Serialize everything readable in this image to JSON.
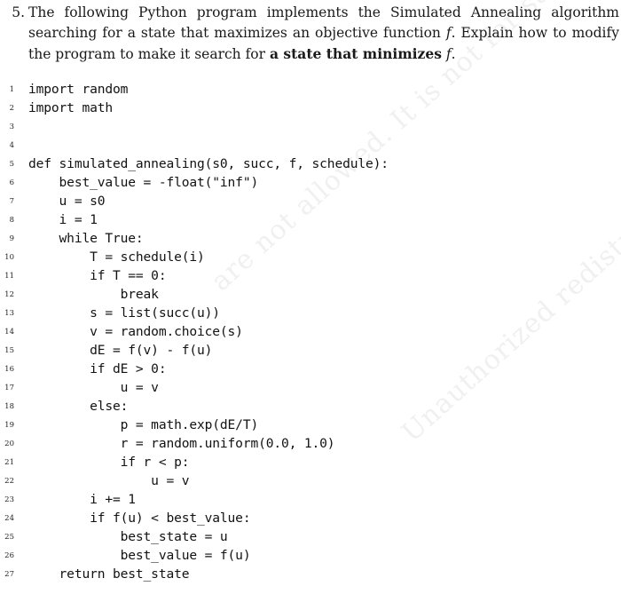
{
  "document": {
    "kind": "textbook-exercise",
    "background_color": "#ffffff",
    "text_color": "#1a1a1a",
    "code_color": "#121212",
    "line_number_color": "#1f1f1f",
    "watermark_color": "#f0f0f0"
  },
  "watermark": {
    "line_1": "are not allowed. It is not for sale.",
    "line_2": "Unauthorized redistributions",
    "rotation_deg": -42
  },
  "question": {
    "number": "5.",
    "text_part_1": "The following Python program implements the Simulated Annealing algorithm searching for a state that maximizes an objective function ",
    "var_f_1": "f",
    "text_part_2": ". Explain how to modify the program to make it search for ",
    "bold_phrase": "a state that minimizes",
    "var_f_2": "f",
    "text_part_3": "."
  },
  "code": {
    "language": "python",
    "lines": [
      {
        "number": "1",
        "text": "import random"
      },
      {
        "number": "2",
        "text": "import math"
      },
      {
        "number": "3",
        "text": ""
      },
      {
        "number": "4",
        "text": ""
      },
      {
        "number": "5",
        "text": "def simulated_annealing(s0, succ, f, schedule):"
      },
      {
        "number": "6",
        "text": "    best_value = -float(\"inf\")"
      },
      {
        "number": "7",
        "text": "    u = s0"
      },
      {
        "number": "8",
        "text": "    i = 1"
      },
      {
        "number": "9",
        "text": "    while True:"
      },
      {
        "number": "10",
        "text": "        T = schedule(i)"
      },
      {
        "number": "11",
        "text": "        if T == 0:"
      },
      {
        "number": "12",
        "text": "            break"
      },
      {
        "number": "13",
        "text": "        s = list(succ(u))"
      },
      {
        "number": "14",
        "text": "        v = random.choice(s)"
      },
      {
        "number": "15",
        "text": "        dE = f(v) - f(u)"
      },
      {
        "number": "16",
        "text": "        if dE > 0:"
      },
      {
        "number": "17",
        "text": "            u = v"
      },
      {
        "number": "18",
        "text": "        else:"
      },
      {
        "number": "19",
        "text": "            p = math.exp(dE/T)"
      },
      {
        "number": "20",
        "text": "            r = random.uniform(0.0, 1.0)"
      },
      {
        "number": "21",
        "text": "            if r < p:"
      },
      {
        "number": "22",
        "text": "                u = v"
      },
      {
        "number": "23",
        "text": "        i += 1"
      },
      {
        "number": "24",
        "text": "        if f(u) < best_value:"
      },
      {
        "number": "25",
        "text": "            best_state = u"
      },
      {
        "number": "26",
        "text": "            best_value = f(u)"
      },
      {
        "number": "27",
        "text": "    return best_state"
      }
    ]
  }
}
